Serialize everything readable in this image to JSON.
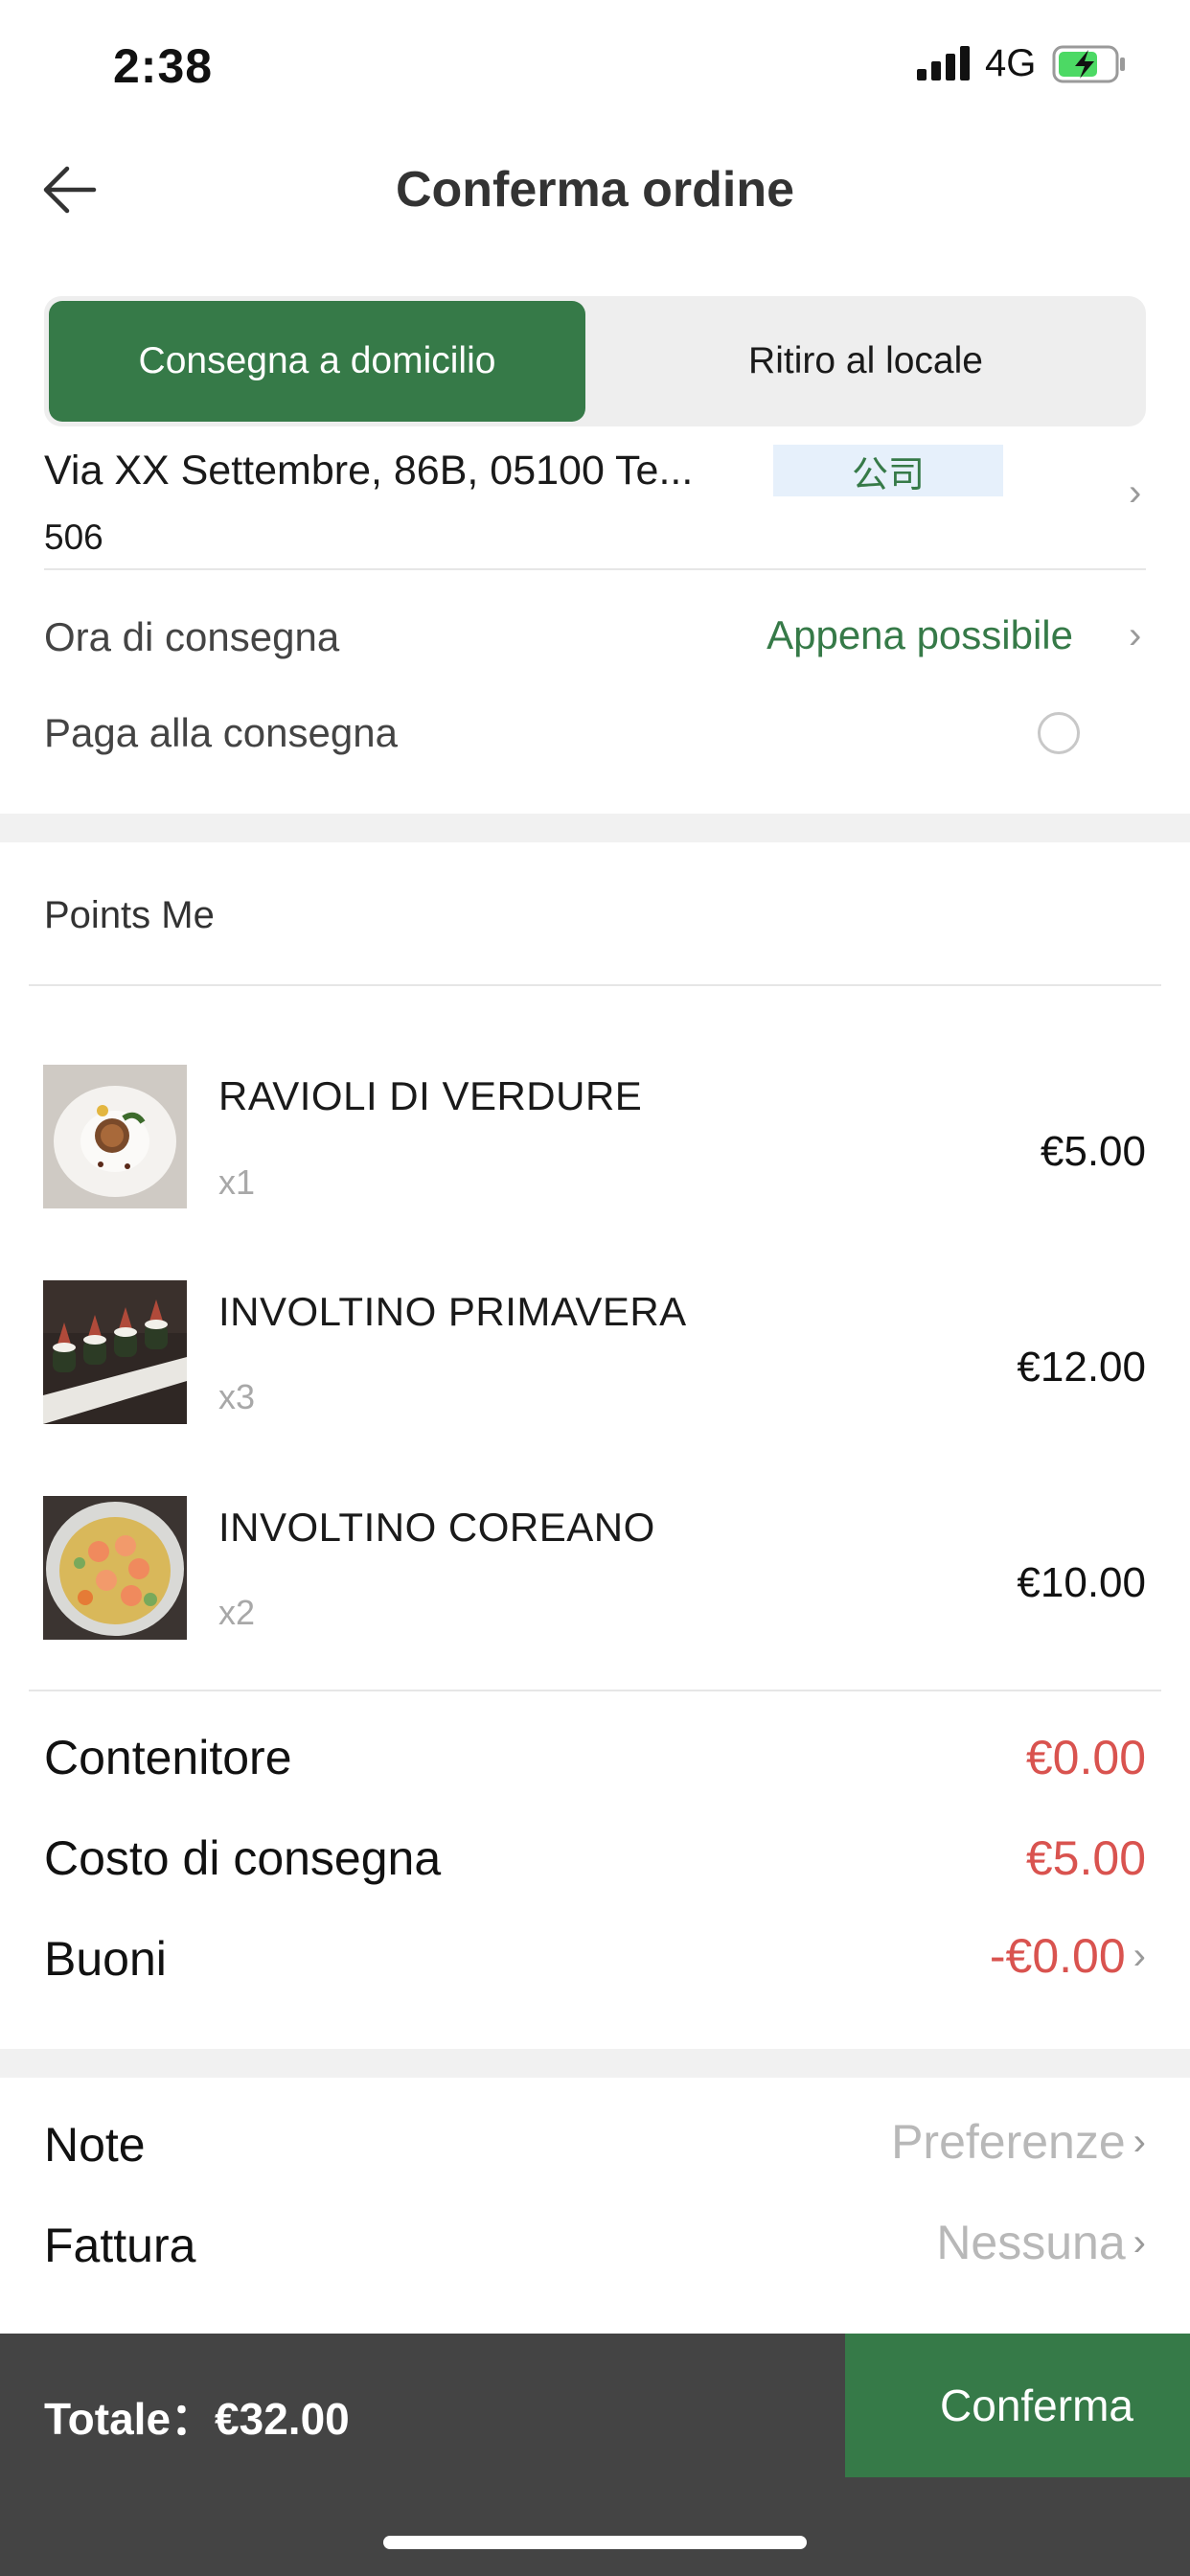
{
  "status_bar": {
    "time": "2:38",
    "network": "4G"
  },
  "header": {
    "title": "Conferma ordine"
  },
  "delivery_mode": {
    "options": [
      "Consegna a domicilio",
      "Ritiro al locale"
    ],
    "selected": "Consegna a domicilio"
  },
  "address": {
    "line1": "Via XX Settembre, 86B, 05100 Te...",
    "tag": "公司",
    "line2": "506"
  },
  "delivery_time": {
    "label": "Ora di consegna",
    "value": "Appena possibile"
  },
  "pay_on_delivery": {
    "label": "Paga alla consegna",
    "checked": false
  },
  "shop": {
    "name": "Points Me"
  },
  "items": [
    {
      "name": "RAVIOLI DI VERDURE",
      "qty": "x1",
      "price": "€5.00",
      "icon": "ravioli-photo"
    },
    {
      "name": "INVOLTINO PRIMAVERA",
      "qty": "x3",
      "price": "€12.00",
      "icon": "spring-roll-photo"
    },
    {
      "name": "INVOLTINO COREANO",
      "qty": "x2",
      "price": "€10.00",
      "icon": "korean-roll-photo"
    }
  ],
  "summary": [
    {
      "label": "Contenitore",
      "value": "€0.00"
    },
    {
      "label": "Costo di consegna",
      "value": "€5.00"
    },
    {
      "label": "Buoni",
      "value": "-€0.00"
    }
  ],
  "options": [
    {
      "label": "Note",
      "value": "Preferenze"
    },
    {
      "label": "Fattura",
      "value": "Nessuna"
    }
  ],
  "footer": {
    "total": "Totale：€32.00",
    "confirm_label": "Conferma"
  },
  "colors": {
    "accent": "#367a48",
    "price_red": "#d9534f",
    "bar_dark": "#444444"
  }
}
